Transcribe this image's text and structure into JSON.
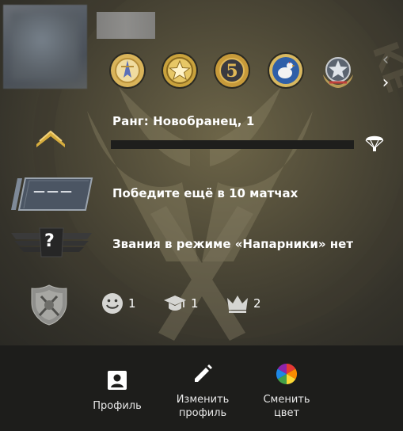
{
  "player": {
    "rank_label": "Ранг: Новобранец, 1",
    "rank_progress": 0,
    "wins_hint": "Победите ещё в 10 матчах",
    "skill_group_placeholder": "———",
    "wingman_text": "Звания в режиме «Напарники» нет",
    "wingman_icon_mark": "?"
  },
  "medals": [
    {
      "icon": "service-medal-icon",
      "color": "#d9b45a"
    },
    {
      "icon": "star-coin-icon",
      "color": "#c9a23c"
    },
    {
      "icon": "five-year-coin-icon",
      "color": "#c79a3a",
      "label": "5"
    },
    {
      "icon": "chicken-coin-icon",
      "color": "#2f5fa8"
    },
    {
      "icon": "star-wreath-icon",
      "color": "#8a939c"
    }
  ],
  "nav": {
    "prev_arrow": "‹",
    "next_arrow": "›"
  },
  "stats": [
    {
      "icon": "smiley-icon",
      "value": "1"
    },
    {
      "icon": "graduation-cap-icon",
      "value": "1"
    },
    {
      "icon": "crown-icon",
      "value": "2"
    }
  ],
  "footer": {
    "profile_label": "Профиль",
    "edit_label": "Изменить\nпрофиль",
    "color_label": "Сменить\nцвет"
  },
  "colors": {
    "accent_gold": "#c9a23c",
    "card_bg": "#4e4937",
    "footer_bg": "#1d1d1b",
    "progress_track": "#1e1e1c"
  }
}
